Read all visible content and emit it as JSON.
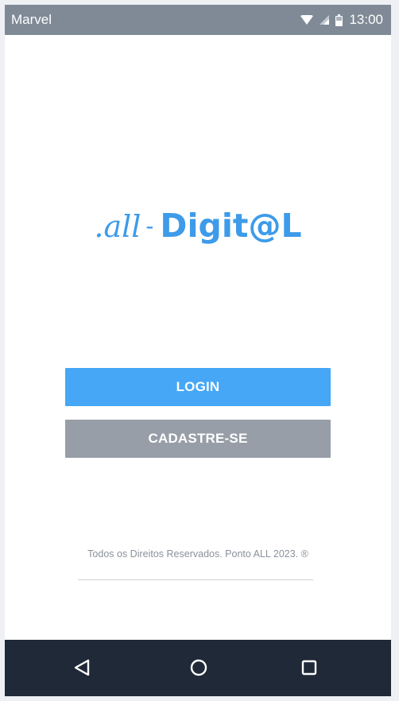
{
  "status_bar": {
    "carrier": "Marvel",
    "time": "13:00",
    "icons": [
      "wifi-icon",
      "signal-icon",
      "battery-icon"
    ]
  },
  "logo": {
    "script_part": ".all",
    "separator": "-",
    "brand_part": "Digit@L",
    "color": "#3d9be9"
  },
  "buttons": {
    "login_label": "LOGIN",
    "signup_label": "CADASTRE-SE",
    "login_color": "#45a7f6",
    "signup_color": "#979ea7"
  },
  "footer": {
    "text": "Todos os Direitos Reservados. Ponto ALL 2023. ®"
  },
  "nav_bar": {
    "icons": [
      "back-icon",
      "home-icon",
      "recent-apps-icon"
    ]
  }
}
